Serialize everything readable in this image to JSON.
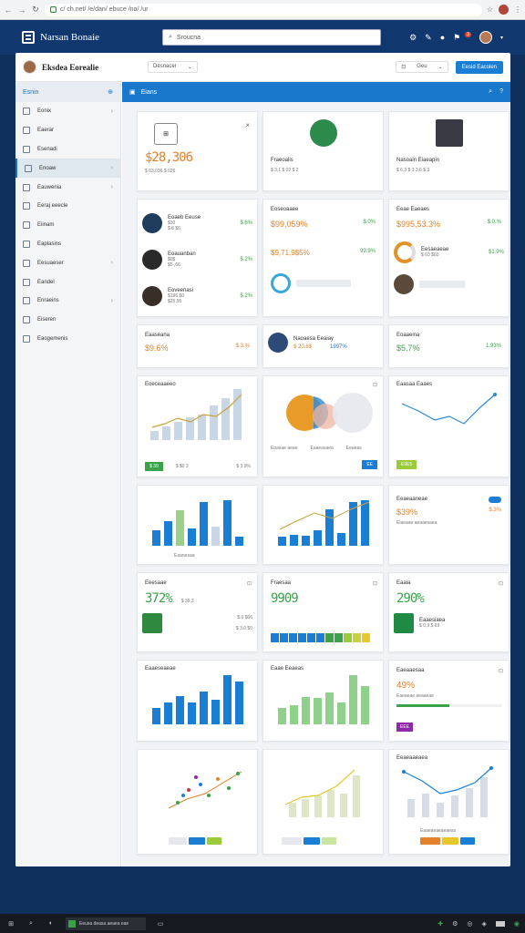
{
  "browser": {
    "url": "c/ ch.net/ /e/dan/ ebuce /na/ /ur"
  },
  "app": {
    "title": "Narsan Bonaie",
    "search_placeholder": "Sroucna"
  },
  "header": {
    "title": "Eksdea Eorealie",
    "dropdown": "Desnacer",
    "filter_label": "Geu",
    "button_label": "Eesid Eacolen"
  },
  "sidebar": {
    "heading": "Esnin",
    "items": [
      {
        "label": "Eonix",
        "chev": true
      },
      {
        "label": "Eaerar",
        "chev": false
      },
      {
        "label": "Esenadi",
        "chev": false
      },
      {
        "label": "Enoaw",
        "chev": true,
        "active": true
      },
      {
        "label": "Eauwenia",
        "chev": true
      },
      {
        "label": "Eeraj eeecle",
        "chev": false
      },
      {
        "label": "Eiinam",
        "chev": false
      },
      {
        "label": "Eaplasins",
        "chev": false
      },
      {
        "label": "Eesuaeser",
        "chev": true
      },
      {
        "label": "Eandel",
        "chev": false
      },
      {
        "label": "Enraeins",
        "chev": true
      },
      {
        "label": "Eiseren",
        "chev": false
      },
      {
        "label": "Eaogemenis",
        "chev": false
      }
    ]
  },
  "main": {
    "title": "Eians"
  },
  "cards": {
    "c1": {
      "value": "$28,306",
      "sub": "$ 03.036 $ 026"
    },
    "c2": {
      "name": "Fraeoalis",
      "sub": "$ 3,1 $ 02 $ 2"
    },
    "c3": {
      "name": "Nasoain Eiaeapin",
      "sub": "$ 6,3 $ 3 3,6 $ 3"
    },
    "c4": {
      "rows": [
        {
          "name": "Eoaeb Eeuse",
          "val1": "$30",
          "val2": "$.6 $6",
          "pct": "$.6%"
        },
        {
          "name": "Eoauanban",
          "val1": "$0$",
          "val2": "$5 ,66",
          "pct": "$.2%"
        },
        {
          "name": "Eoveenasi",
          "val1": "$196 $0",
          "val2": "$25.95",
          "pct": "$.2%"
        }
      ]
    },
    "c5": {
      "title": "Eoseoaaee",
      "value": "$99,059%",
      "pct": "$.0%",
      "value2": "$9,71,9$5%",
      "pct2": "99.9%"
    },
    "c6": {
      "title": "Eeae Eaeaes",
      "value": "$995,53.3%",
      "pct": "$.0.%",
      "rows": [
        {
          "title": "Eesaeaeae",
          "sub": "$ 03 $03"
        }
      ],
      "pct2": "$1.9%"
    },
    "c7": {
      "title": "Eaaseana",
      "value": "$9.6%",
      "pct": "$.3.%"
    },
    "c8": {
      "title": "Naoaesa Eeaiay",
      "value": "$ 20,6$",
      "pct": "1997%"
    },
    "c9": {
      "title": "Eoaaeina",
      "value": "$5.7%",
      "pct": "1.93%"
    },
    "c10": {
      "title": "Eoeceaaeeo",
      "btn": "$ 39",
      "sub": "$ $0 3",
      "pct": "$ 3,9%"
    },
    "c11": {
      "legend": [
        "Eoasae aeae",
        "Eaaeasaea",
        "Eeaeas"
      ],
      "btn": "EE"
    },
    "c12": {
      "title": "Eaasaa Eaaes",
      "btn": "E9E5"
    },
    "c13": {
      "label": "Eaanesaa"
    },
    "c15": {
      "title": "Eeaeaaneae",
      "value": "$39%",
      "sub": "Eiaeaae aeaaesaea",
      "pct": "$.3%"
    },
    "c16": {
      "title": "Eeesaae",
      "value": "372%",
      "sub": "$ 39,3",
      "rows": [
        {
          "val": "$.0 $66"
        },
        {
          "val": "$ 3.0 $0"
        }
      ]
    },
    "c17": {
      "title": "Fraesaa",
      "value": "9909"
    },
    "c18": {
      "title": "Eaaia",
      "value": "290%",
      "rows": [
        {
          "name": "Eaaesiaea",
          "sub": "$ 0,9 $ 69"
        }
      ]
    },
    "c19": {
      "title": "Eaaeseaeae"
    },
    "c20": {
      "title": "Eaae Eeaeas"
    },
    "c21": {
      "title": "Eaeaaesaa",
      "value": "49%",
      "sub": "Eaeaeae aeaaeae",
      "btn": "EEE"
    },
    "c24": {
      "title": "Eeaeaaeaea",
      "sub": "Eaaeaeaeaeaeas"
    }
  },
  "chart_data": [
    {
      "type": "bar",
      "values": [
        8,
        12,
        16,
        20,
        22,
        30,
        36,
        44
      ]
    },
    {
      "type": "bar",
      "values": [
        25,
        40,
        58,
        28,
        72,
        32,
        75,
        15
      ]
    },
    {
      "type": "bar",
      "values": [
        18,
        22,
        20,
        30,
        70,
        25,
        85,
        88
      ]
    },
    {
      "type": "bar",
      "values": [
        30,
        40,
        52,
        40,
        60,
        45,
        90,
        78
      ]
    },
    {
      "type": "bar",
      "values": [
        30,
        35,
        50,
        48,
        58,
        40,
        90,
        70
      ]
    }
  ],
  "taskbar": {
    "app_label": "Eeusa deasa aeaea eae"
  }
}
